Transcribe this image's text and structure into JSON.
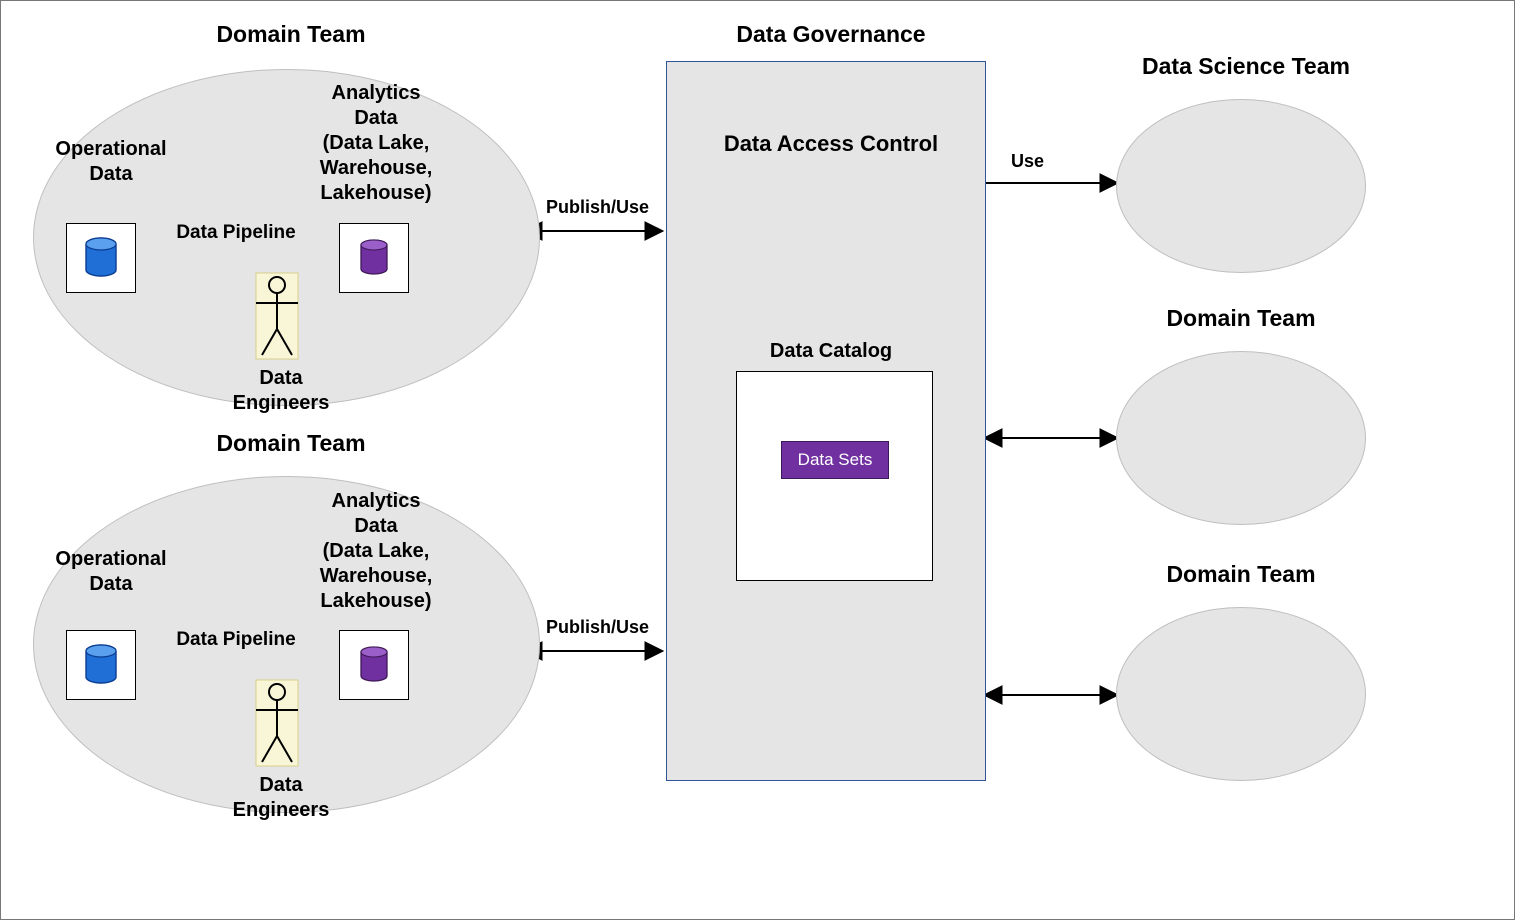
{
  "domain_team_title": "Domain Team",
  "data_governance_title": "Data Governance",
  "data_science_team_title": "Data Science Team",
  "data_access_control": "Data Access Control",
  "data_catalog_label": "Data Catalog",
  "data_sets_label": "Data Sets",
  "operational_data_label": "Operational\nData",
  "analytics_data_label": "Analytics\nData\n(Data Lake,\nWarehouse,\nLakehouse)",
  "data_pipeline_label": "Data Pipeline",
  "data_engineers_label": "Data\nEngineers",
  "publish_use_label": "Publish/Use",
  "use_label": "Use"
}
